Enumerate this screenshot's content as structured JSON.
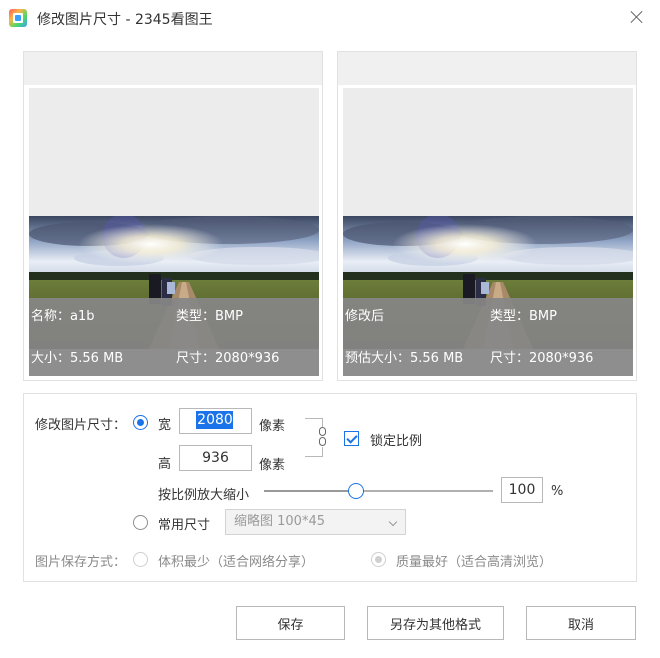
{
  "window": {
    "title": "修改图片尺寸 - 2345看图王"
  },
  "icons": {
    "app": "2345-viewer-app-icon",
    "close": "close-icon",
    "link": "chain-link-icon",
    "dropdown": "chevron-down-icon"
  },
  "colors": {
    "accent": "#1a73e8",
    "info_overlay": "#878787",
    "panel_header": "#f0f0f0"
  },
  "preview": {
    "original": {
      "name": "名称：a1b",
      "type": "类型：BMP",
      "size": "大小：5.56 MB",
      "dimensions": "尺寸：2080*936"
    },
    "modified": {
      "name": "修改后",
      "type": "类型：BMP",
      "size": "预估大小：5.56 MB",
      "dimensions": "尺寸：2080*936"
    }
  },
  "resize": {
    "label": "修改图片尺寸：",
    "width_label": "宽",
    "width_value": "2080",
    "height_label": "高",
    "height_value": "936",
    "unit": "像素",
    "lock_ratio_label": "锁定比例",
    "lock_ratio_checked": true,
    "scale_label": "按比例放大缩小",
    "scale_value": "100",
    "scale_unit": "%",
    "scale_fraction": 0.4,
    "common_size_label": "常用尺寸",
    "common_size_selected": "缩略图 100*45"
  },
  "save_mode": {
    "label": "图片保存方式：",
    "option_min": "体积最少（适合网络分享）",
    "option_quality": "质量最好（适合高清浏览）"
  },
  "buttons": {
    "save": "保存",
    "save_as": "另存为其他格式",
    "cancel": "取消"
  }
}
